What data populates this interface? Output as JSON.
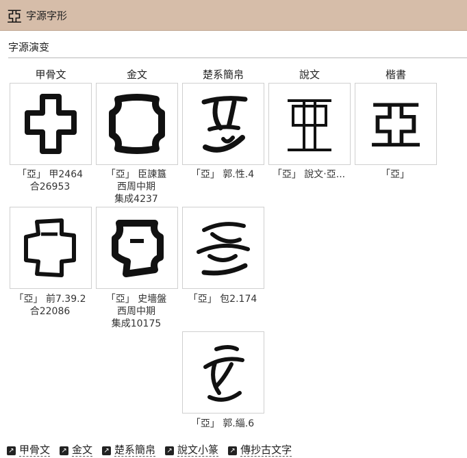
{
  "header": {
    "char": "亞",
    "title": "字源字形"
  },
  "section": {
    "title": "字源演变"
  },
  "columns": [
    "甲骨文",
    "金文",
    "楚系簡帛",
    "說文",
    "楷書"
  ],
  "glyphs": [
    {
      "caption": [
        "「亞」 甲2464",
        "合26953"
      ]
    },
    {
      "caption": [
        "「亞」 臣諫簋",
        "西周中期",
        "集成4237"
      ]
    },
    {
      "caption": [
        "「亞」 郭.性.4"
      ]
    },
    {
      "caption": [
        "「亞」 說文‧亞..."
      ]
    },
    {
      "caption": [
        "「亞」"
      ],
      "glyph_char": "亞"
    },
    {
      "caption": [
        "「亞」 前7.39.2",
        "合22086"
      ]
    },
    {
      "caption": [
        "「亞」 史墻盤",
        "西周中期",
        "集成10175"
      ]
    },
    {
      "caption": [
        "「亞」 包2.174"
      ]
    },
    {
      "caption": [
        "「亞」 郭.緇.6"
      ]
    }
  ],
  "links": [
    "甲骨文",
    "金文",
    "楚系簡帛",
    "說文小篆",
    "傳抄古文字"
  ],
  "link_icon": "external-link-icon"
}
